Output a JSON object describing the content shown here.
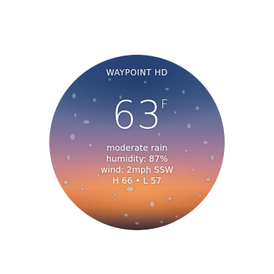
{
  "watch": {
    "brand": "WAYPOINT HD",
    "temperature": "63",
    "unit": "F",
    "condition": "moderate rain",
    "humidity": "humidity: 87%",
    "wind": "wind: 2mph SSW",
    "high_low": "H 66 • L 57"
  }
}
